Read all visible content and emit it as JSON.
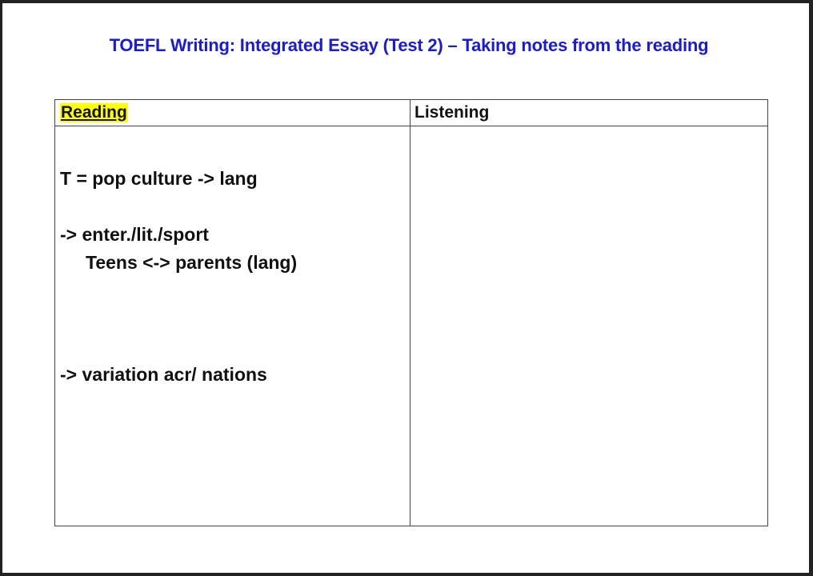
{
  "title": "TOEFL Writing: Integrated Essay (Test 2) – Taking notes from the reading",
  "table": {
    "headers": {
      "reading": "Reading",
      "listening": "Listening"
    },
    "reading_notes": [
      "T = pop culture -> lang",
      "-> enter./lit./sport",
      "Teens <-> parents (lang)",
      "-> variation acr/ nations"
    ],
    "listening_notes": []
  },
  "colors": {
    "title": "#1a1adb",
    "highlight": "#ffff00"
  }
}
